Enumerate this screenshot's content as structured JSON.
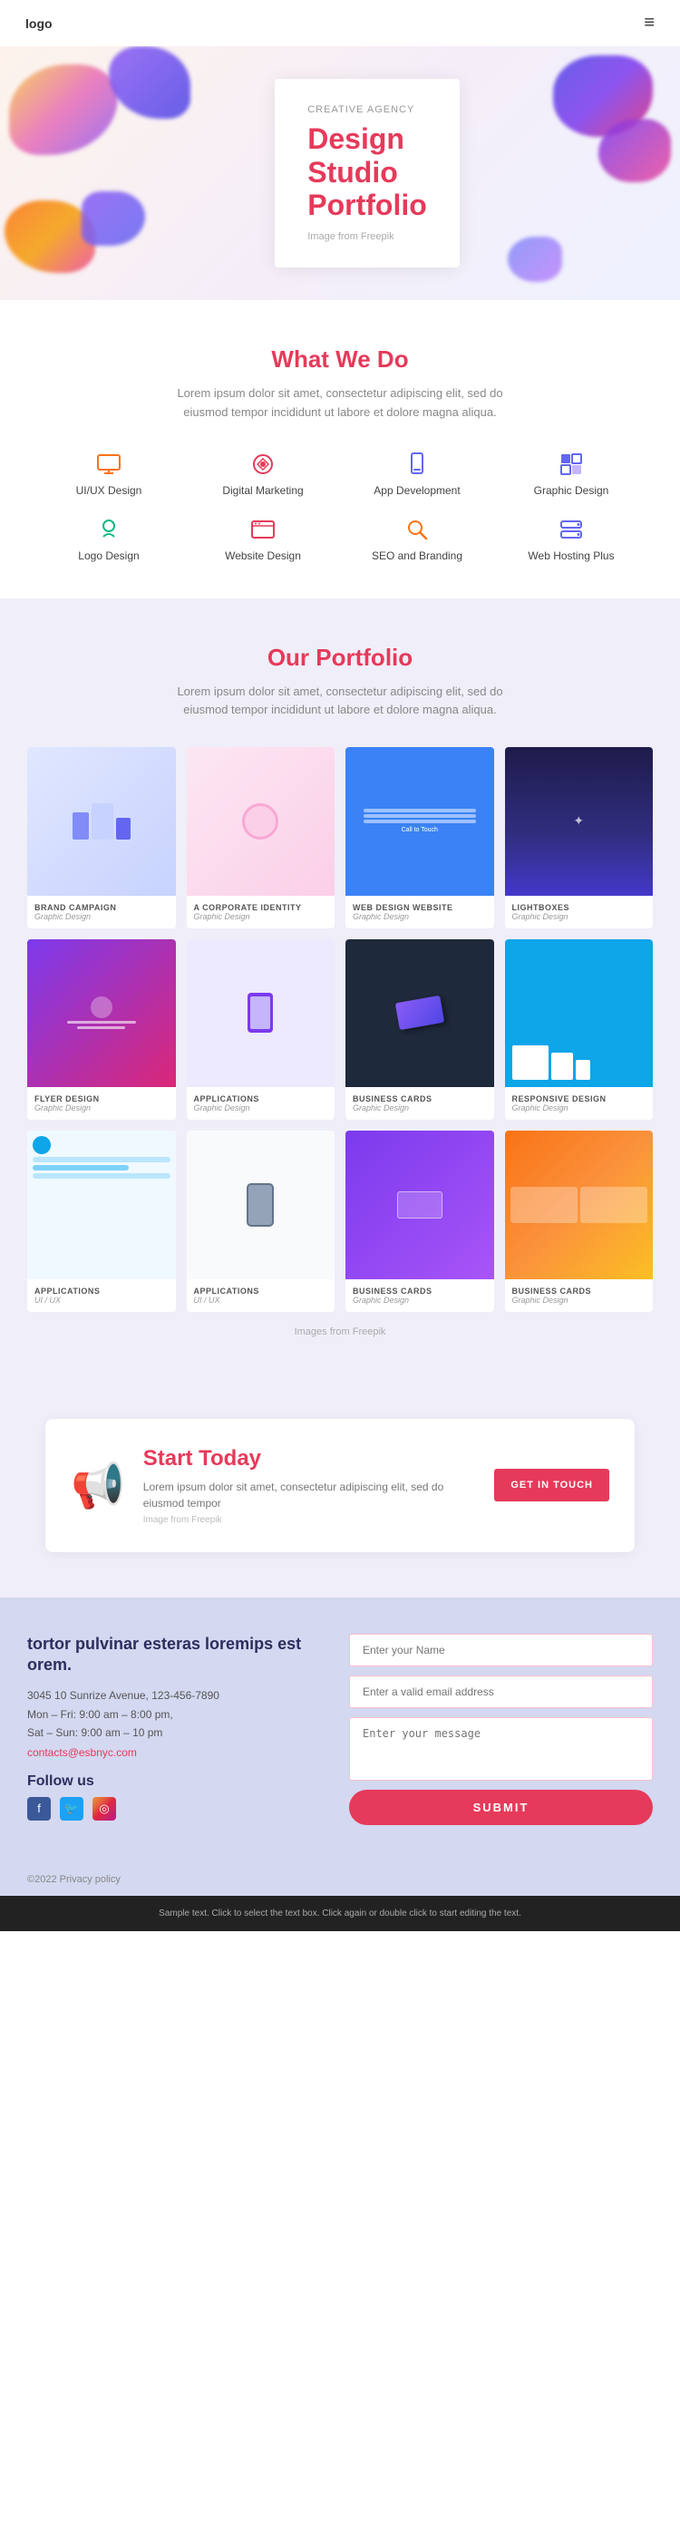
{
  "header": {
    "logo": "logo",
    "menu_icon": "≡"
  },
  "hero": {
    "label": "CREATIVE AGENCY",
    "title_line1": "Design",
    "title_line2": "Studio",
    "title_line3": "Portfolio",
    "image_credit": "Image from Freepik"
  },
  "what_we_do": {
    "title": "What We Do",
    "description": "Lorem ipsum dolor sit amet, consectetur adipiscing elit, sed do eiusmod tempor incididunt ut labore et dolore magna aliqua.",
    "services": [
      {
        "id": "uiux",
        "label": "UI/UX Design"
      },
      {
        "id": "dm",
        "label": "Digital Marketing"
      },
      {
        "id": "app",
        "label": "App Development"
      },
      {
        "id": "gd",
        "label": "Graphic Design"
      },
      {
        "id": "logo",
        "label": "Logo Design"
      },
      {
        "id": "web",
        "label": "Website Design"
      },
      {
        "id": "seo",
        "label": "SEO and Branding"
      },
      {
        "id": "hosting",
        "label": "Web Hosting Plus"
      }
    ]
  },
  "portfolio": {
    "title": "Our Portfolio",
    "description": "Lorem ipsum dolor sit amet, consectetur adipiscing elit, sed do eiusmod tempor incididunt ut labore et dolore magna aliqua.",
    "images_credit": "Images from Freepik",
    "items": [
      {
        "category": "BRAND CAMPAIGN",
        "sub": "Graphic Design",
        "img": "brand"
      },
      {
        "category": "A CORPORATE IDENTITY",
        "sub": "Graphic Design",
        "img": "corp"
      },
      {
        "category": "WEB DESIGN WEBSITE",
        "sub": "Graphic Design",
        "img": "webdesign"
      },
      {
        "category": "LIGHTBOXES",
        "sub": "Graphic Design",
        "img": "light"
      },
      {
        "category": "FLYER DESIGN",
        "sub": "Graphic Design",
        "img": "flyer"
      },
      {
        "category": "APPLICATIONS",
        "sub": "Graphic Design",
        "img": "app"
      },
      {
        "category": "BUSINESS CARDS",
        "sub": "Graphic Design",
        "img": "bizcard"
      },
      {
        "category": "RESPONSIVE DESIGN",
        "sub": "Graphic Design",
        "img": "resp"
      },
      {
        "category": "APPLICATIONS",
        "sub": "UI / UX",
        "img": "appui"
      },
      {
        "category": "APPLICATIONS",
        "sub": "UI / UX",
        "img": "appui2"
      },
      {
        "category": "BUSINESS CARDS",
        "sub": "Graphic Design",
        "img": "biz2"
      },
      {
        "category": "BUSINESS CARDS",
        "sub": "Graphic Design",
        "img": "biz3"
      }
    ]
  },
  "start_today": {
    "title": "Start Today",
    "description": "Lorem ipsum dolor sit amet, consectetur adipiscing elit, sed do eiusmod tempor",
    "image_credit": "Image from Freepik",
    "button_label": "GET IN TOUCH"
  },
  "footer": {
    "heading": "tortor pulvinar esteras loremips est orem.",
    "address": "3045 10 Sunrize Avenue, 123-456-7890",
    "hours1": "Mon – Fri: 9:00 am – 8:00 pm,",
    "hours2": "Sat – Sun: 9:00 am – 10 pm",
    "email": "contacts@esbnyc.com",
    "follow_title": "Follow us",
    "social": [
      {
        "id": "facebook",
        "icon": "f",
        "class": "social-fb"
      },
      {
        "id": "twitter",
        "icon": "t",
        "class": "social-tw"
      },
      {
        "id": "instagram",
        "icon": "◎",
        "class": "social-ig"
      }
    ],
    "form": {
      "name_placeholder": "Enter your Name",
      "email_placeholder": "Enter a valid email address",
      "message_placeholder": "Enter your message",
      "submit_label": "SUBMIT"
    },
    "copyright": "©2022 Privacy policy"
  },
  "bottom_bar": {
    "text": "Sample text. Click to select the text box. Click again or double click to start editing the text."
  }
}
